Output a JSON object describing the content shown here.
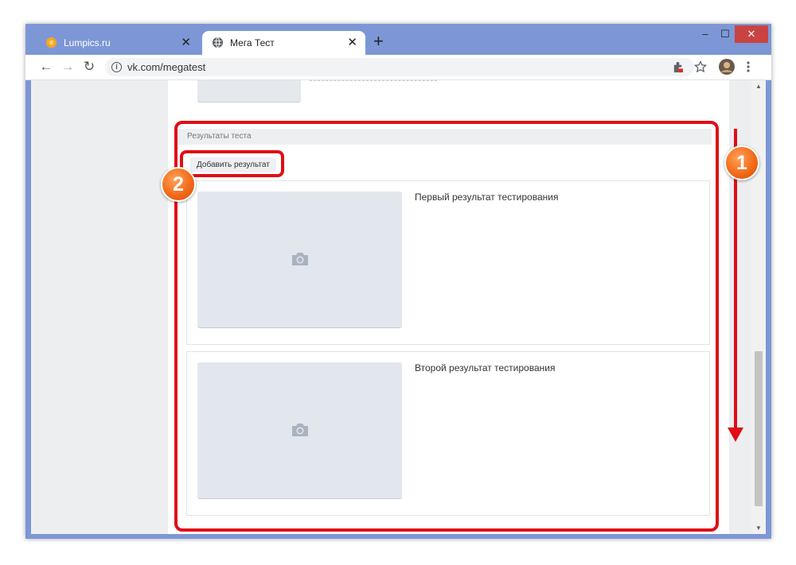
{
  "tabs": [
    {
      "title": "Lumpics.ru",
      "close": "✕"
    },
    {
      "title": "Мега Тест",
      "close": "✕"
    }
  ],
  "new_tab": "+",
  "window_controls": {
    "minimize": "‒",
    "maximize": "☐",
    "close": "✕"
  },
  "nav": {
    "back": "←",
    "forward": "→",
    "reload": "↻"
  },
  "address": {
    "url": "vk.com/megatest",
    "info": "i"
  },
  "toolbar_icons": [
    "extension-icon",
    "star-icon",
    "avatar",
    "menu-icon"
  ],
  "section": {
    "title": "Результаты теста",
    "add_button": "Добавить результат"
  },
  "results": [
    {
      "title": "Первый результат тестирования"
    },
    {
      "title": "Второй результат тестирования"
    }
  ],
  "annotations": {
    "step1": "1",
    "step2": "2"
  },
  "colors": {
    "annotation": "#e00e16",
    "badge": "#f36b1a",
    "frame": "#7d97d6",
    "image_placeholder": "#e2e7ee"
  }
}
